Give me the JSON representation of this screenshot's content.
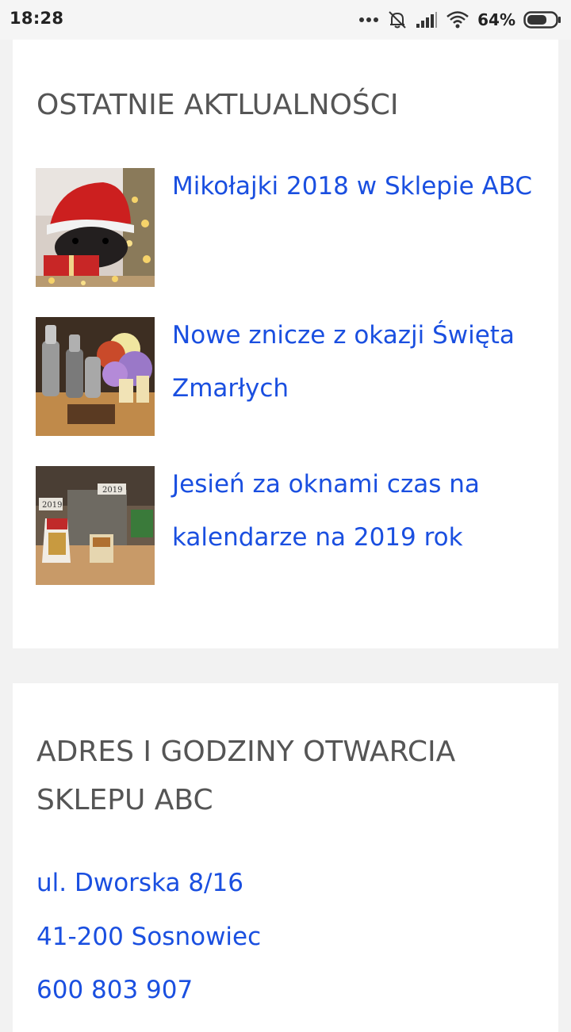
{
  "status_bar": {
    "time": "18:28",
    "battery_percent": "64%",
    "icons": [
      "more-dots-icon",
      "alarm-off-icon",
      "signal-icon",
      "wifi-icon",
      "battery-icon"
    ]
  },
  "news_section": {
    "title": "OSTATNIE AKTLUALNOŚCI",
    "items": [
      {
        "title": "Mikołajki 2018 w Sklepie ABC",
        "image": "dog-santa-hat-photo"
      },
      {
        "title": "Nowe znicze z okazji Święta Zmarłych",
        "image": "candles-flowers-photo"
      },
      {
        "title": "Jesień za oknami czas na kalendarze na 2019 rok",
        "image": "calendars-2019-photo"
      }
    ]
  },
  "address_section": {
    "title": "ADRES I GODZINY OTWARCIA SKLEPU ABC",
    "lines": [
      "ul. Dworska 8/16",
      "41-200 Sosnowiec",
      "600 803 907"
    ]
  },
  "colors": {
    "link": "#1a4fe0",
    "heading": "#555555",
    "card_bg": "#ffffff",
    "page_bg": "#f2f2f2"
  }
}
